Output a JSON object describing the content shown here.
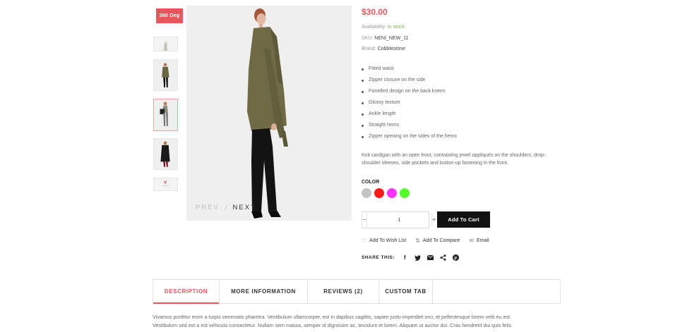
{
  "badge": "360 Deg",
  "image_nav": {
    "prev": "PREV",
    "separator": "/",
    "next": "NEXT"
  },
  "product": {
    "price": "$30.00",
    "availability_label": "Availability:",
    "availability_value": "In stock",
    "sku_label": "SKU:",
    "sku_value": "NENI_NEW_11",
    "brand_label": "Brand:",
    "brand_value": "Cobblestone",
    "features": [
      "Fitted waist",
      "Zipper closure on the side",
      "Panelled design on the back knees",
      "Glossy texture",
      "Ankle length",
      "Straight hems",
      "Zipper opening on the sides of the hems"
    ],
    "description": "Knit cardigan with an open front, contrasting jewel appliqués on the shoulders, drop-shoulder sleeves, side pockets and button-up fastening in the front.",
    "color_label": "COLOR",
    "colors": [
      "#c4c4c4",
      "#ff1a1a",
      "#ff33ff",
      "#55ff2a"
    ],
    "quantity": "1",
    "add_to_cart": "Add To Cart",
    "wishlist": "Add To Wish List",
    "compare": "Add To Compare",
    "email": "Email",
    "share_label": "SHARE THIS:"
  },
  "tabs": [
    "DESCRIPTION",
    "MORE INFORMATION",
    "REVIEWS (2)",
    "CUSTOM TAB"
  ],
  "body_text": [
    "Vivamus porttitor enim a turpis venenatis pharetra. Vestibulum ullamcorper, est in dapibus sagittis, sapien justo imperdiet orci, et pellentesque lorem velit eu est.",
    "Vestibulum sed est a est vehicula consectetur. Nullam sem massa, semper id dignissim ac, tincidunt et lorem. Aliquam ut auctor dui. Cras hendrerit dui quis felis"
  ]
}
